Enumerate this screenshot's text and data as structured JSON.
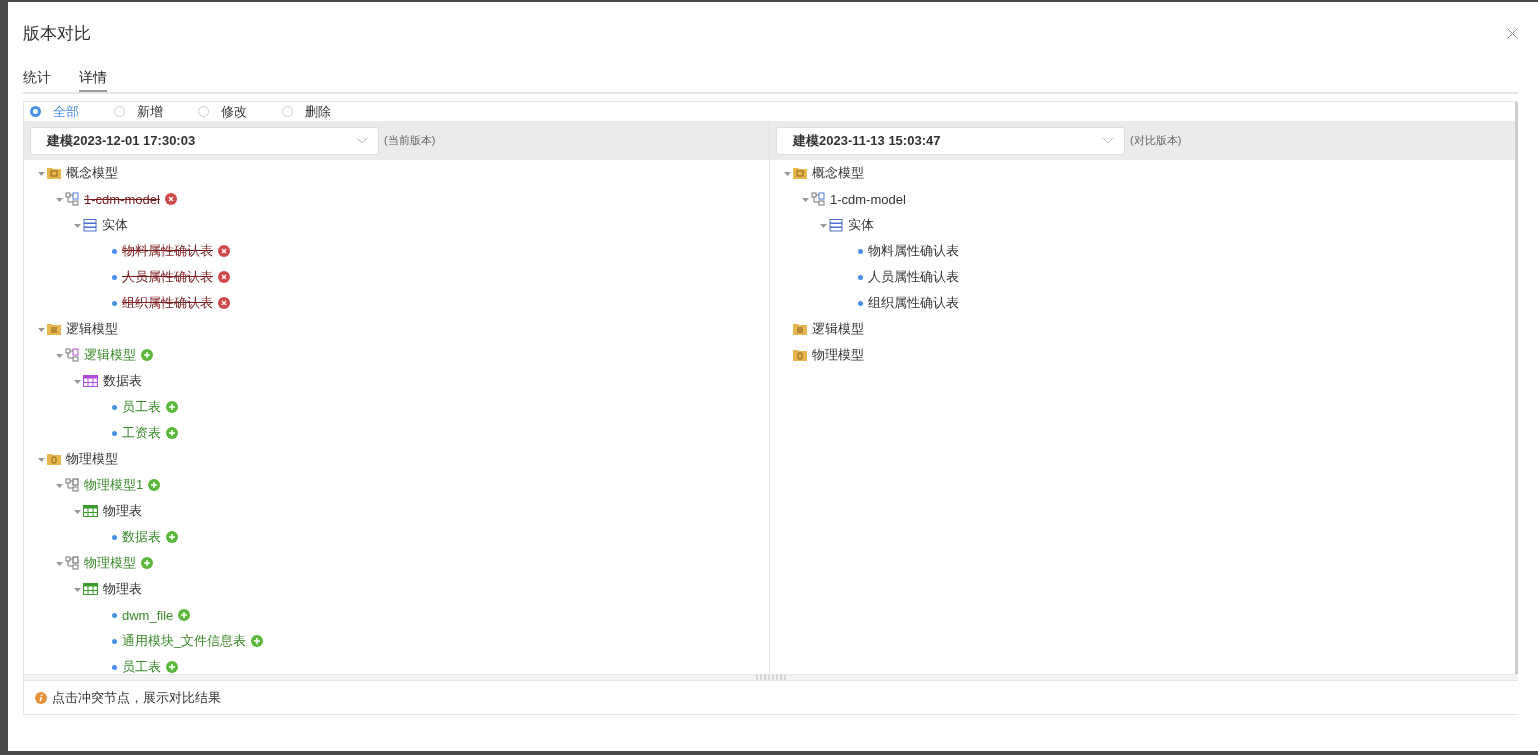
{
  "dialog": {
    "title": "版本对比"
  },
  "tabs": [
    {
      "label": "统计",
      "selected": false
    },
    {
      "label": "详情",
      "selected": true
    }
  ],
  "filters": [
    {
      "label": "全部",
      "selected": true
    },
    {
      "label": "新增",
      "selected": false
    },
    {
      "label": "修改",
      "selected": false
    },
    {
      "label": "删除",
      "selected": false
    }
  ],
  "panes": [
    {
      "version": "建模2023-12-01 17:30:03",
      "version_note": "(当前版本)",
      "tree": [
        {
          "kind": "concept-folder",
          "label": "概念模型",
          "added": false,
          "deleted": false,
          "expanded": true,
          "children": [
            {
              "kind": "concept-model",
              "label": "1-cdm-model",
              "added": false,
              "deleted": true,
              "expanded": true,
              "children": [
                {
                  "kind": "entity-group",
                  "label": "实体",
                  "added": false,
                  "deleted": false,
                  "expanded": true,
                  "children": [
                    {
                      "kind": "leaf",
                      "label": "物料属性确认表",
                      "added": false,
                      "deleted": true
                    },
                    {
                      "kind": "leaf",
                      "label": "人员属性确认表",
                      "added": false,
                      "deleted": true
                    },
                    {
                      "kind": "leaf",
                      "label": "组织属性确认表",
                      "added": false,
                      "deleted": true
                    }
                  ]
                }
              ]
            }
          ]
        },
        {
          "kind": "logic-folder",
          "label": "逻辑模型",
          "added": false,
          "deleted": false,
          "expanded": true,
          "children": [
            {
              "kind": "logic-model",
              "label": "逻辑模型",
              "added": true,
              "deleted": false,
              "expanded": true,
              "children": [
                {
                  "kind": "data-group",
                  "label": "数据表",
                  "added": false,
                  "deleted": false,
                  "expanded": true,
                  "children": [
                    {
                      "kind": "leaf",
                      "label": "员工表",
                      "added": true,
                      "deleted": false
                    },
                    {
                      "kind": "leaf",
                      "label": "工资表",
                      "added": true,
                      "deleted": false
                    }
                  ]
                }
              ]
            }
          ]
        },
        {
          "kind": "physical-folder",
          "label": "物理模型",
          "added": false,
          "deleted": false,
          "expanded": true,
          "children": [
            {
              "kind": "physical-model",
              "label": "物理模型1",
              "added": true,
              "deleted": false,
              "expanded": true,
              "children": [
                {
                  "kind": "table-group",
                  "label": "物理表",
                  "added": false,
                  "deleted": false,
                  "expanded": true,
                  "children": [
                    {
                      "kind": "leaf",
                      "label": "数据表",
                      "added": true,
                      "deleted": false
                    }
                  ]
                }
              ]
            },
            {
              "kind": "physical-model",
              "label": "物理模型",
              "added": true,
              "deleted": false,
              "expanded": true,
              "children": [
                {
                  "kind": "table-group",
                  "label": "物理表",
                  "added": false,
                  "deleted": false,
                  "expanded": true,
                  "children": [
                    {
                      "kind": "leaf",
                      "label": "dwm_file",
                      "added": true,
                      "deleted": false
                    },
                    {
                      "kind": "leaf",
                      "label": "通用模块_文件信息表",
                      "added": true,
                      "deleted": false
                    },
                    {
                      "kind": "leaf",
                      "label": "员工表",
                      "added": true,
                      "deleted": false
                    }
                  ]
                }
              ]
            }
          ]
        }
      ]
    },
    {
      "version": "建模2023-11-13 15:03:47",
      "version_note": "(对比版本)",
      "tree": [
        {
          "kind": "concept-folder",
          "label": "概念模型",
          "added": false,
          "deleted": false,
          "expanded": true,
          "children": [
            {
              "kind": "concept-model",
              "label": "1-cdm-model",
              "added": false,
              "deleted": false,
              "expanded": true,
              "children": [
                {
                  "kind": "entity-group",
                  "label": "实体",
                  "added": false,
                  "deleted": false,
                  "expanded": true,
                  "children": [
                    {
                      "kind": "leaf",
                      "label": "物料属性确认表",
                      "added": false,
                      "deleted": false
                    },
                    {
                      "kind": "leaf",
                      "label": "人员属性确认表",
                      "added": false,
                      "deleted": false
                    },
                    {
                      "kind": "leaf",
                      "label": "组织属性确认表",
                      "added": false,
                      "deleted": false
                    }
                  ]
                }
              ]
            }
          ]
        },
        {
          "kind": "logic-folder",
          "label": "逻辑模型",
          "added": false,
          "deleted": false
        },
        {
          "kind": "physical-folder",
          "label": "物理模型",
          "added": false,
          "deleted": false
        }
      ]
    }
  ],
  "hint": "点击冲突节点，展示对比结果"
}
